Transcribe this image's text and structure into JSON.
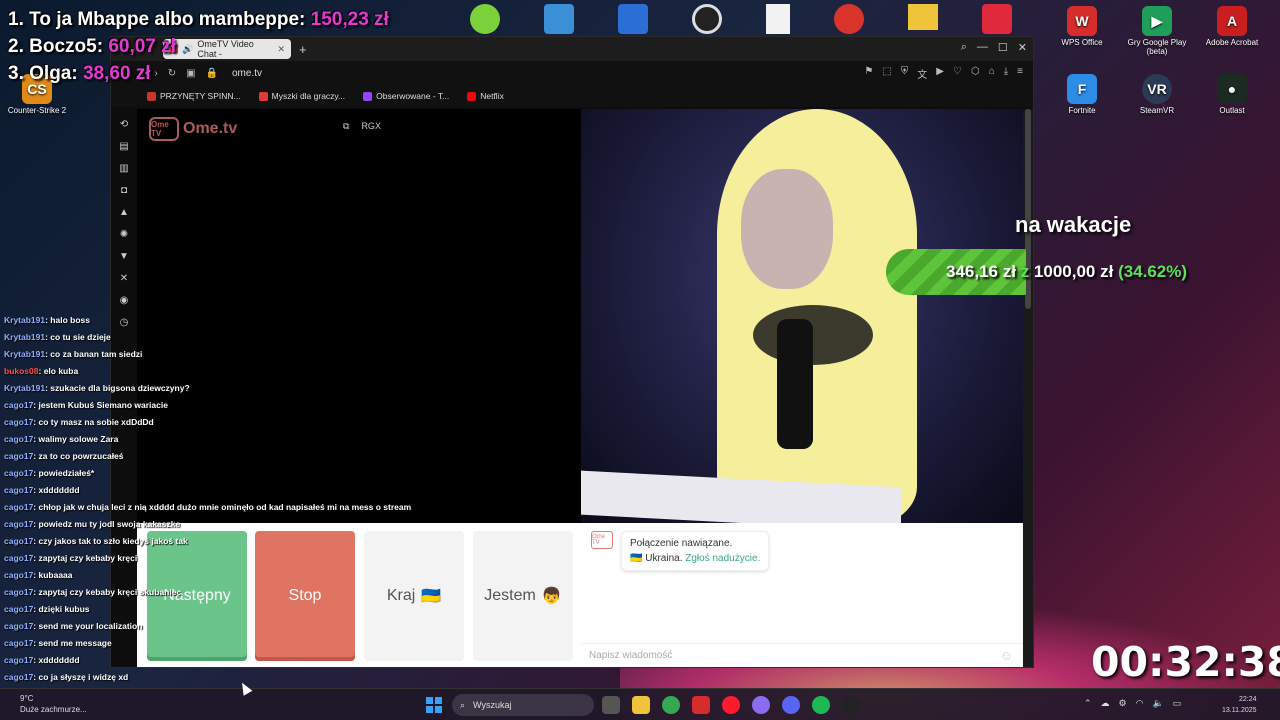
{
  "leaderboard": [
    {
      "rank": "1.",
      "name": "To ja Mbappe albo mambeppe:",
      "amount": "150,23 zł"
    },
    {
      "rank": "2.",
      "name": "Boczo5:",
      "amount": "60,07 zł"
    },
    {
      "rank": "3.",
      "name": "Olga:",
      "amount": "38,60 zł"
    }
  ],
  "desktop_icons": [
    {
      "label": "WPS Office",
      "icon": "wps-office-icon",
      "color": "#d62c2c"
    },
    {
      "label": "Gry Google Play (beta)",
      "icon": "google-play-games-icon",
      "color": "#1f9e5a"
    },
    {
      "label": "Adobe Acrobat",
      "icon": "adobe-acrobat-icon",
      "color": "#c81e1e"
    },
    {
      "label": "Fortnite",
      "icon": "fortnite-icon",
      "color": "#2d8ce6"
    },
    {
      "label": "SteamVR",
      "icon": "steamvr-icon",
      "color": "#2b3a55"
    },
    {
      "label": "Outlast",
      "icon": "outlast-icon",
      "color": "#1b2a22"
    },
    {
      "label": "Counter-Strike 2",
      "icon": "counter-strike-icon",
      "color": "#e08a1a"
    }
  ],
  "browser": {
    "tab_title": "OmeTV Video Chat -",
    "url": "ome.tv",
    "bookmarks": [
      {
        "label": "PRZYNĘTY SPINN...",
        "color": "#c0392b"
      },
      {
        "label": "Myszki dla graczy...",
        "color": "#e03a3a"
      },
      {
        "label": "Obserwowane - T...",
        "color": "#9146ff"
      },
      {
        "label": "Netflix",
        "color": "#e50914"
      }
    ]
  },
  "ometv": {
    "logo_text": "Ome.tv",
    "logo_box": "Ome TV",
    "buttons": {
      "next": "Następny",
      "stop": "Stop",
      "country": "Kraj",
      "country_flag": "🇺🇦",
      "gender": "Jestem",
      "gender_emoji": "👦"
    },
    "chat": {
      "line1": "Połączenie nawiązane.",
      "line2_country": "Ukraina.",
      "line2_link": "Zgłoś nadużycie.",
      "placeholder": "Napisz wiadomość"
    }
  },
  "twitch_chat": [
    {
      "user": "Krytab191",
      "text": ": halo boss",
      "color": "blue"
    },
    {
      "user": "Krytab191",
      "text": ": co tu sie dzieje",
      "color": "blue"
    },
    {
      "user": "Krytab191",
      "text": ": co za banan tam siedzi",
      "color": "blue"
    },
    {
      "user": "bukos08",
      "text": ": elo kuba",
      "color": "red"
    },
    {
      "user": "Krytab191",
      "text": ": szukacie dla bigsona dziewczyny?",
      "color": "blue"
    },
    {
      "user": "cago17",
      "text": ": jestem Kubuś Siemano wariacie",
      "color": "blue"
    },
    {
      "user": "cago17",
      "text": ": co ty masz na sobie xdDdDd",
      "color": "blue"
    },
    {
      "user": "cago17",
      "text": ": walimy solowe Zara",
      "color": "blue"
    },
    {
      "user": "cago17",
      "text": ": za to co powrzucałeś",
      "color": "blue"
    },
    {
      "user": "cago17",
      "text": ": powiedziałeś*",
      "color": "blue"
    },
    {
      "user": "cago17",
      "text": ": xddddddd",
      "color": "blue"
    },
    {
      "user": "cago17",
      "text": ": chłop jak w chuja leci z nią xdddd dużo mnie ominęło od kad napisałeś mi na mess o stream",
      "color": "blue"
    },
    {
      "user": "cago17",
      "text": ": powiedz mu ty jodl swoja kakaszke",
      "color": "blue"
    },
    {
      "user": "cago17",
      "text": ": czy jakos tak to szło kiedyś jakoś tak",
      "color": "blue"
    },
    {
      "user": "cago17",
      "text": ": zapytaj czy kebaby kręci",
      "color": "blue"
    },
    {
      "user": "cago17",
      "text": ": kubaaaa",
      "color": "blue"
    },
    {
      "user": "cago17",
      "text": ": zapytaj czy kebaby kręci skubaniec",
      "color": "blue"
    },
    {
      "user": "cago17",
      "text": ": dzięki kubus",
      "color": "blue"
    },
    {
      "user": "cago17",
      "text": ": send me your localization",
      "color": "blue"
    },
    {
      "user": "cago17",
      "text": ": send me message",
      "color": "blue"
    },
    {
      "user": "cago17",
      "text": ": xddddddd",
      "color": "blue"
    },
    {
      "user": "cago17",
      "text": ": co ja słyszę i widzę xd",
      "color": "blue"
    }
  ],
  "goal": {
    "title": "na wakacje",
    "current": "346,16 zł",
    "separator": "z",
    "target": "1000,00 zł",
    "percent": "(34.62%)",
    "progress": 0.3462
  },
  "timer": "00:32:38",
  "taskbar": {
    "weather_temp": "9°C",
    "weather_desc": "Duże zachmurze...",
    "search_placeholder": "Wyszukaj",
    "time": "22:24",
    "date": "13.11.2025"
  },
  "colors": {
    "accent_green": "#6bc58b",
    "accent_red": "#e07462",
    "donation_magenta": "#e33bd2",
    "chat_user_blue": "#8fb0ff"
  }
}
